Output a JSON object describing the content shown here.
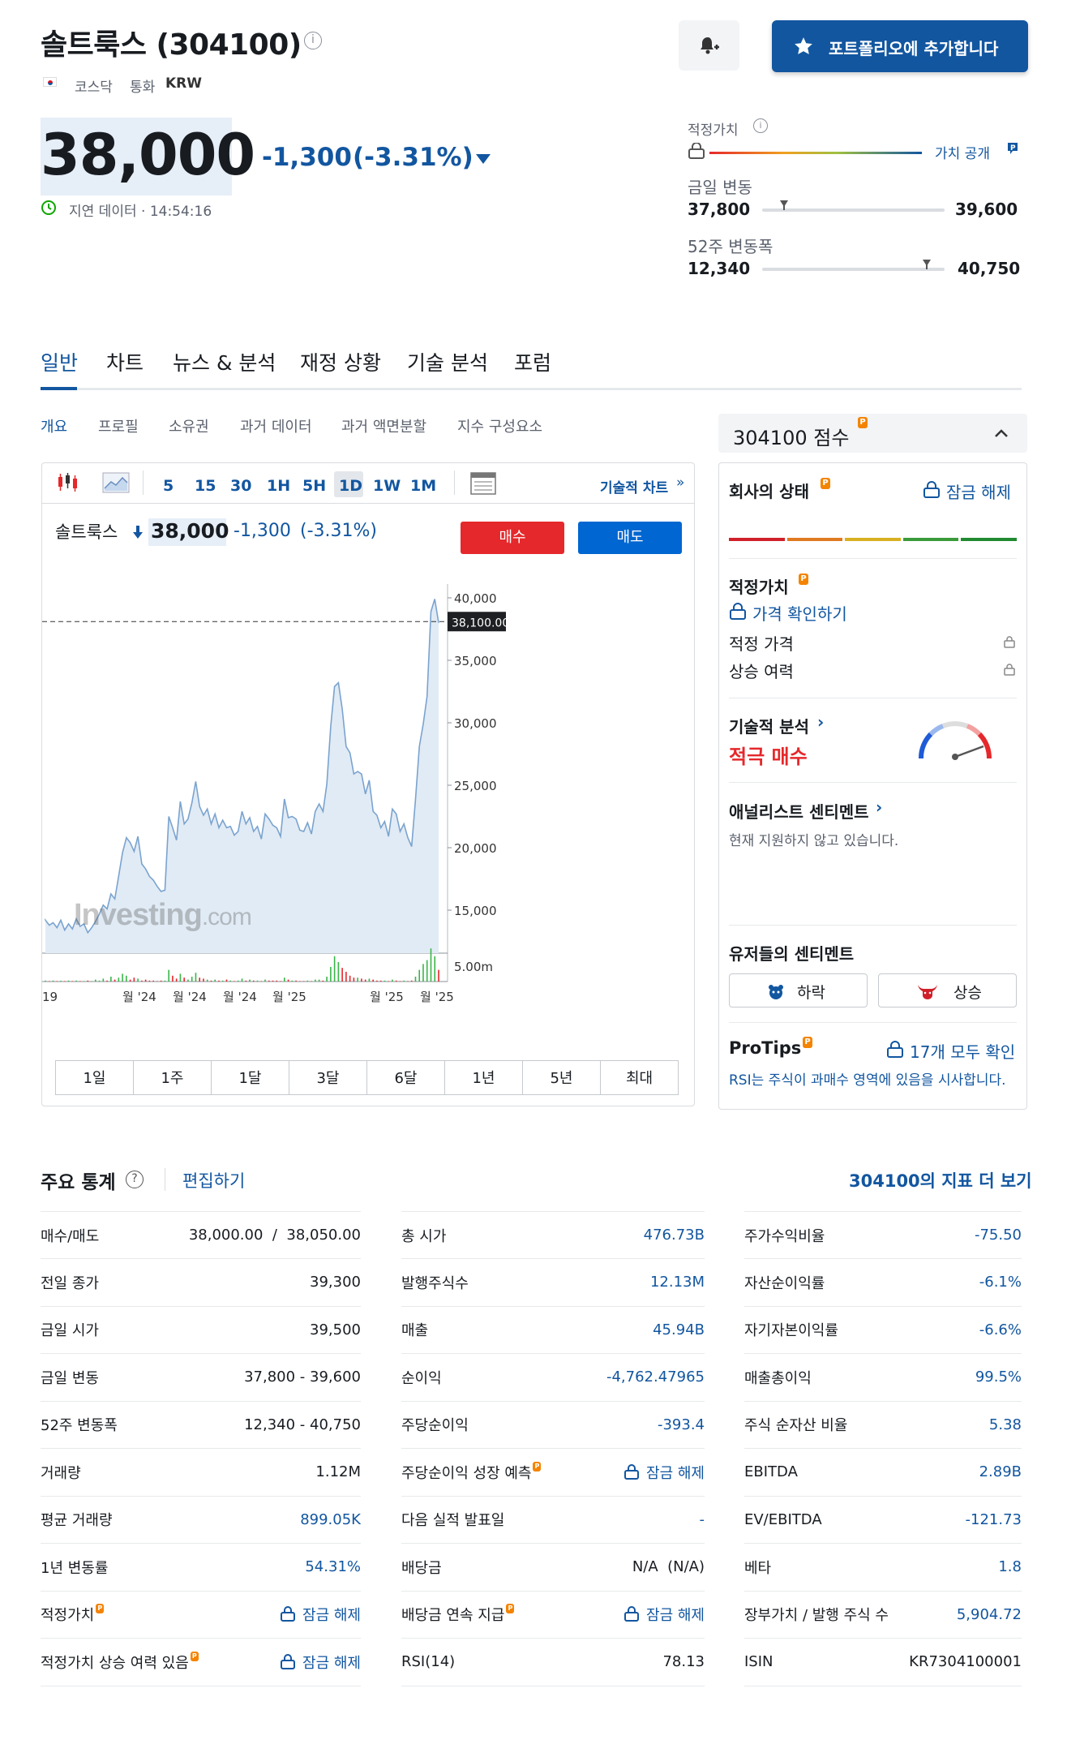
{
  "header": {
    "title": "솔트룩스 (304100)",
    "exchange": "코스닥",
    "currency_label": "통화",
    "currency": "KRW",
    "add_portfolio": "포트폴리오에 추가합니다"
  },
  "quote": {
    "price": "38,000",
    "change": "-1,300",
    "change_pct": "(-3.31%)",
    "delay_text": "지연 데이터 · 14:54:16"
  },
  "fair_value": {
    "label": "적정가치",
    "reveal": "가치 공개"
  },
  "day_range": {
    "label": "금일 변동",
    "low": "37,800",
    "high": "39,600",
    "position": 0.12
  },
  "week52_range": {
    "label": "52주 변동폭",
    "low": "12,340",
    "high": "40,750",
    "position": 0.9
  },
  "main_tabs": [
    "일반",
    "차트",
    "뉴스 & 분석",
    "재정 상황",
    "기술 분석",
    "포럼"
  ],
  "sub_tabs": [
    "개요",
    "프로필",
    "소유권",
    "과거 데이터",
    "과거 액면분할",
    "지수 구성요소"
  ],
  "chart_toolbar": {
    "intervals": [
      "5",
      "15",
      "30",
      "1H",
      "5H",
      "1D",
      "1W",
      "1M"
    ],
    "active": "1D",
    "tech_chart": "기술적 차트"
  },
  "chart_header": {
    "name": "솔트룩스",
    "price": "38,000",
    "change": "-1,300",
    "change_pct": "(-3.31%)",
    "buy": "매수",
    "sell": "매도",
    "current_label": "38,100.00",
    "watermark_main": "Investing",
    "watermark_suffix": ".com",
    "volume_label": "5.00m"
  },
  "chart_data": {
    "type": "area",
    "y_ticks": [
      "40,000",
      "35,000",
      "30,000",
      "25,000",
      "20,000",
      "15,000"
    ],
    "x_ticks": [
      "19",
      "월 '24",
      "월 '24",
      "월 '24",
      "월 '25",
      "월 '25",
      "월 '25"
    ],
    "ylim": [
      10000,
      42000
    ],
    "reference_line": 38100,
    "values": [
      14200,
      13800,
      14000,
      13600,
      14200,
      13400,
      13900,
      13500,
      14300,
      13700,
      13900,
      13200,
      13600,
      14100,
      14700,
      15400,
      15100,
      16300,
      15900,
      17700,
      19600,
      20800,
      20400,
      19700,
      20900,
      18700,
      18300,
      17700,
      17400,
      16900,
      16500,
      16600,
      22500,
      21600,
      20600,
      23700,
      21900,
      22300,
      23600,
      25300,
      23300,
      22600,
      23100,
      21900,
      22700,
      21600,
      22200,
      21600,
      21700,
      21000,
      21300,
      22900,
      21900,
      22400,
      21300,
      21700,
      20700,
      22700,
      22300,
      21800,
      21600,
      20900,
      23900,
      22400,
      22500,
      22300,
      21400,
      21300,
      22000,
      21100,
      22900,
      23500,
      22900,
      25100,
      29700,
      32900,
      33200,
      31100,
      28100,
      27600,
      25900,
      26100,
      25900,
      24300,
      25400,
      22900,
      22600,
      21600,
      22100,
      20900,
      23100,
      22700,
      21300,
      21900,
      20800,
      20100,
      23900,
      28100,
      29900,
      32100,
      38900,
      39900,
      38000
    ],
    "volumes": [
      0.1,
      0.05,
      0.1,
      0.05,
      0.08,
      0.05,
      0.1,
      0.05,
      0.1,
      0.05,
      0.05,
      0.1,
      0.05,
      0.2,
      0.1,
      0.3,
      0.1,
      0.5,
      0.2,
      0.4,
      0.8,
      0.6,
      0.2,
      0.4,
      0.3,
      0.1,
      0.2,
      0.1,
      0.1,
      0.05,
      0.1,
      0.1,
      1.2,
      0.6,
      0.3,
      0.8,
      0.4,
      0.2,
      0.5,
      0.9,
      0.4,
      0.3,
      0.2,
      0.1,
      0.2,
      0.1,
      0.1,
      0.2,
      0.1,
      0.05,
      0.1,
      0.3,
      0.1,
      0.2,
      0.1,
      0.1,
      0.05,
      0.2,
      0.1,
      0.1,
      0.1,
      0.05,
      0.4,
      0.2,
      0.1,
      0.1,
      0.05,
      0.05,
      0.1,
      0.05,
      0.2,
      0.2,
      0.1,
      0.5,
      1.5,
      2.6,
      2.0,
      1.4,
      1.0,
      0.6,
      0.4,
      0.4,
      0.3,
      0.2,
      0.3,
      0.2,
      0.1,
      0.1,
      0.1,
      0.05,
      0.2,
      0.1,
      0.05,
      0.1,
      0.05,
      0.1,
      0.5,
      1.2,
      1.8,
      2.2,
      3.4,
      2.6,
      1.2
    ]
  },
  "ranges": [
    "1일",
    "1주",
    "1달",
    "3달",
    "6달",
    "1년",
    "5년",
    "최대"
  ],
  "score_panel": {
    "title": "304100 점수",
    "company_health": "회사의 상태",
    "unlock": "잠금 해제",
    "fair_value_title": "적정가치",
    "check_price": "가격 확인하기",
    "fair_price": "적정 가격",
    "upside": "상승 여력",
    "tech_title": "기술적 분석",
    "tech_signal": "적극 매수",
    "analyst_title": "애널리스트 센티멘트",
    "analyst_text": "현재 지원하지 않고 있습니다.",
    "user_sentiment": "유저들의 센티멘트",
    "bearish": "하락",
    "bullish": "상승",
    "protips": "ProTips",
    "protips_all": "17개 모두 확인",
    "protips_text": "RSI는 주식이 과매수 영역에 있음을 시사합니다."
  },
  "key_stats": {
    "title": "주요 통계",
    "edit": "편집하기",
    "more": "304100의 지표 더 보기",
    "col1": [
      {
        "k": "매수/매도",
        "v": "38,000.00  /  38,050.00",
        "blue": false
      },
      {
        "k": "전일 종가",
        "v": "39,300",
        "blue": false
      },
      {
        "k": "금일 시가",
        "v": "39,500",
        "blue": false
      },
      {
        "k": "금일 변동",
        "v": "37,800 - 39,600",
        "blue": false
      },
      {
        "k": "52주 변동폭",
        "v": "12,340 - 40,750",
        "blue": false
      },
      {
        "k": "거래량",
        "v": "1.12M",
        "blue": false
      },
      {
        "k": "평균 거래량",
        "v": "899.05K",
        "blue": true
      },
      {
        "k": "1년 변동률",
        "v": "54.31%",
        "blue": true
      },
      {
        "k": "적정가치",
        "v": "잠금 해제",
        "blue": true,
        "lock": true,
        "pro": true
      },
      {
        "k": "적정가치 상승 여력 있음",
        "v": "잠금 해제",
        "blue": true,
        "lock": true,
        "pro": true
      }
    ],
    "col2": [
      {
        "k": "총 시가",
        "v": "476.73B",
        "blue": true
      },
      {
        "k": "발행주식수",
        "v": "12.13M",
        "blue": true
      },
      {
        "k": "매출",
        "v": "45.94B",
        "blue": true
      },
      {
        "k": "순이익",
        "v": "-4,762.47965",
        "blue": true
      },
      {
        "k": "주당순이익",
        "v": "-393.4",
        "blue": true
      },
      {
        "k": "주당순이익 성장 예측",
        "v": "잠금 해제",
        "blue": true,
        "lock": true,
        "pro": true
      },
      {
        "k": "다음 실적 발표일",
        "v": "-",
        "blue": true
      },
      {
        "k": "배당금",
        "v": "N/A  (N/A)",
        "blue": false
      },
      {
        "k": "배당금 연속 지급",
        "v": "잠금 해제",
        "blue": true,
        "lock": true,
        "pro": true
      },
      {
        "k": "RSI(14)",
        "v": "78.13",
        "blue": false
      }
    ],
    "col3": [
      {
        "k": "주가수익비율",
        "v": "-75.50",
        "blue": true
      },
      {
        "k": "자산순이익률",
        "v": "-6.1%",
        "blue": true
      },
      {
        "k": "자기자본이익률",
        "v": "-6.6%",
        "blue": true
      },
      {
        "k": "매출총이익",
        "v": "99.5%",
        "blue": true
      },
      {
        "k": "주식 순자산 비율",
        "v": "5.38",
        "blue": true
      },
      {
        "k": "EBITDA",
        "v": "2.89B",
        "blue": true
      },
      {
        "k": "EV/EBITDA",
        "v": "-121.73",
        "blue": true
      },
      {
        "k": "베타",
        "v": "1.8",
        "blue": true
      },
      {
        "k": "장부가치 / 발행 주식 수",
        "v": "5,904.72",
        "blue": true
      },
      {
        "k": "ISIN",
        "v": "KR7304100001",
        "blue": false
      }
    ]
  },
  "colors": {
    "accent": "#1256a0",
    "negative": "#1256a0",
    "buy": "#e5282b",
    "sell": "#0066d1",
    "signal": "#e5282b"
  }
}
